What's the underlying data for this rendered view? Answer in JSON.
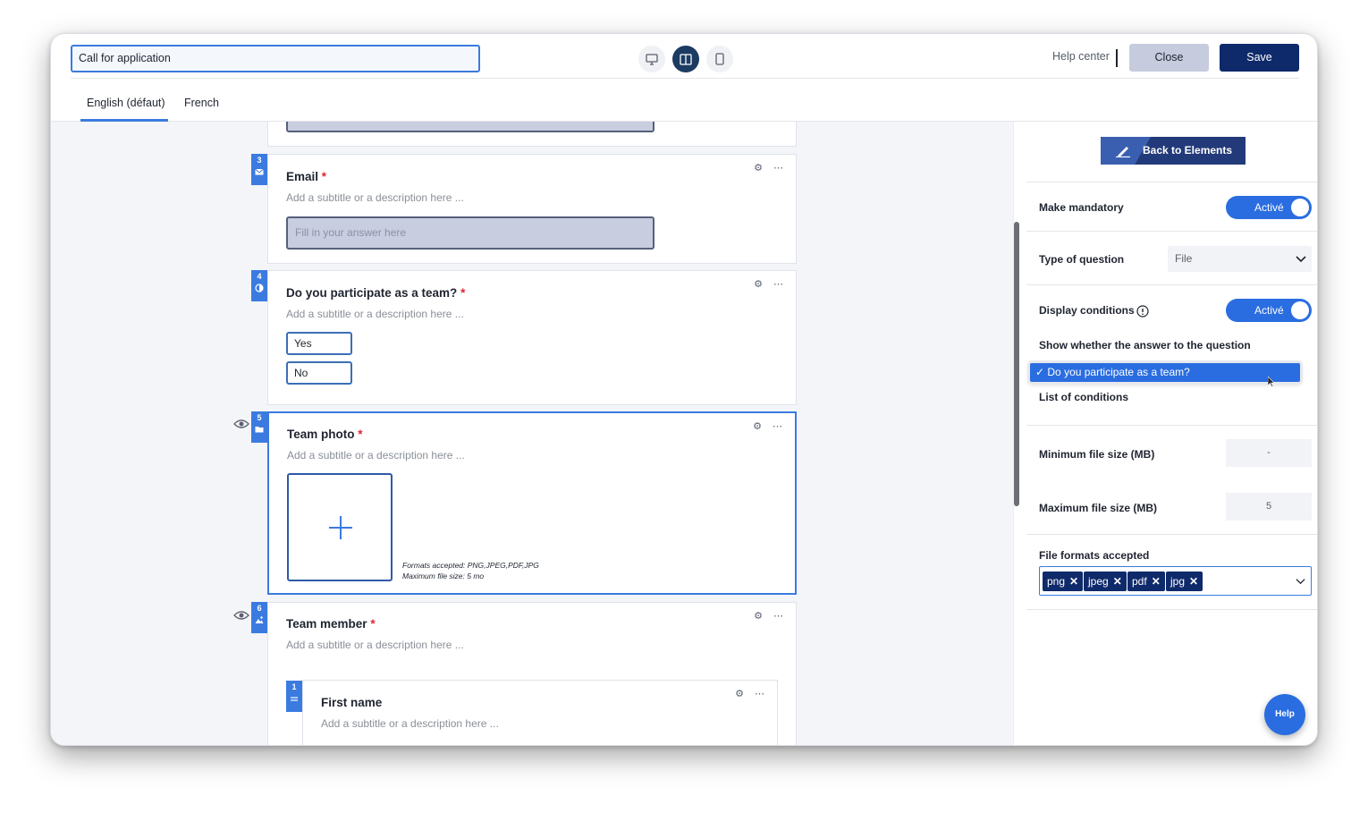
{
  "header": {
    "form_title": "Call for application",
    "help_center": "Help center",
    "close_label": "Close",
    "save_label": "Save",
    "devices": [
      "desktop-icon",
      "split-view-icon",
      "mobile-icon"
    ]
  },
  "tabs": [
    "English (défaut)",
    "French"
  ],
  "questions": [
    {
      "number": "3",
      "title": "Email",
      "required": "*",
      "subtitle": "Add a subtitle or a description here ...",
      "placeholder": "Fill in your answer here",
      "icon": "envelope-icon"
    },
    {
      "number": "4",
      "title": "Do you participate as a team?",
      "required": "*",
      "subtitle": "Add a subtitle or a description here ...",
      "options": [
        "Yes",
        "No"
      ],
      "icon": "radio-icon"
    },
    {
      "number": "5",
      "title": "Team photo",
      "required": "*",
      "subtitle": "Add a subtitle or a description here ...",
      "formats_line": "Formats accepted: PNG,JPEG,PDF,JPG",
      "size_line": "Maximum file size: 5 mo",
      "icon": "folder-icon"
    },
    {
      "number": "6",
      "title": "Team member",
      "required": "*",
      "subtitle": "Add a subtitle or a description here ...",
      "icon": "image-icon",
      "sub_question": {
        "number": "1",
        "title": "First name",
        "subtitle": "Add a subtitle or a description here ..."
      }
    }
  ],
  "panel": {
    "back_label": "Back to Elements",
    "make_mandatory": "Make mandatory",
    "toggle_label": "Activé",
    "type_of_question": "Type of question",
    "type_value": "File",
    "display_conditions": "Display conditions",
    "show_whether": "Show whether the answer to the question",
    "selected_condition": "✓ Do you participate as a team?",
    "list_of_conditions": "List of conditions",
    "min_size_label": "Minimum file size (MB)",
    "min_size_value": "-",
    "max_size_label": "Maximum file size (MB)",
    "max_size_value": "5",
    "file_formats_label": "File formats accepted",
    "formats": [
      "png",
      "jpeg",
      "pdf",
      "jpg"
    ]
  },
  "help_button": "Help",
  "colors": {
    "accent": "#3b7be0",
    "navy": "#0f2a6b",
    "required": "#e0242f"
  }
}
